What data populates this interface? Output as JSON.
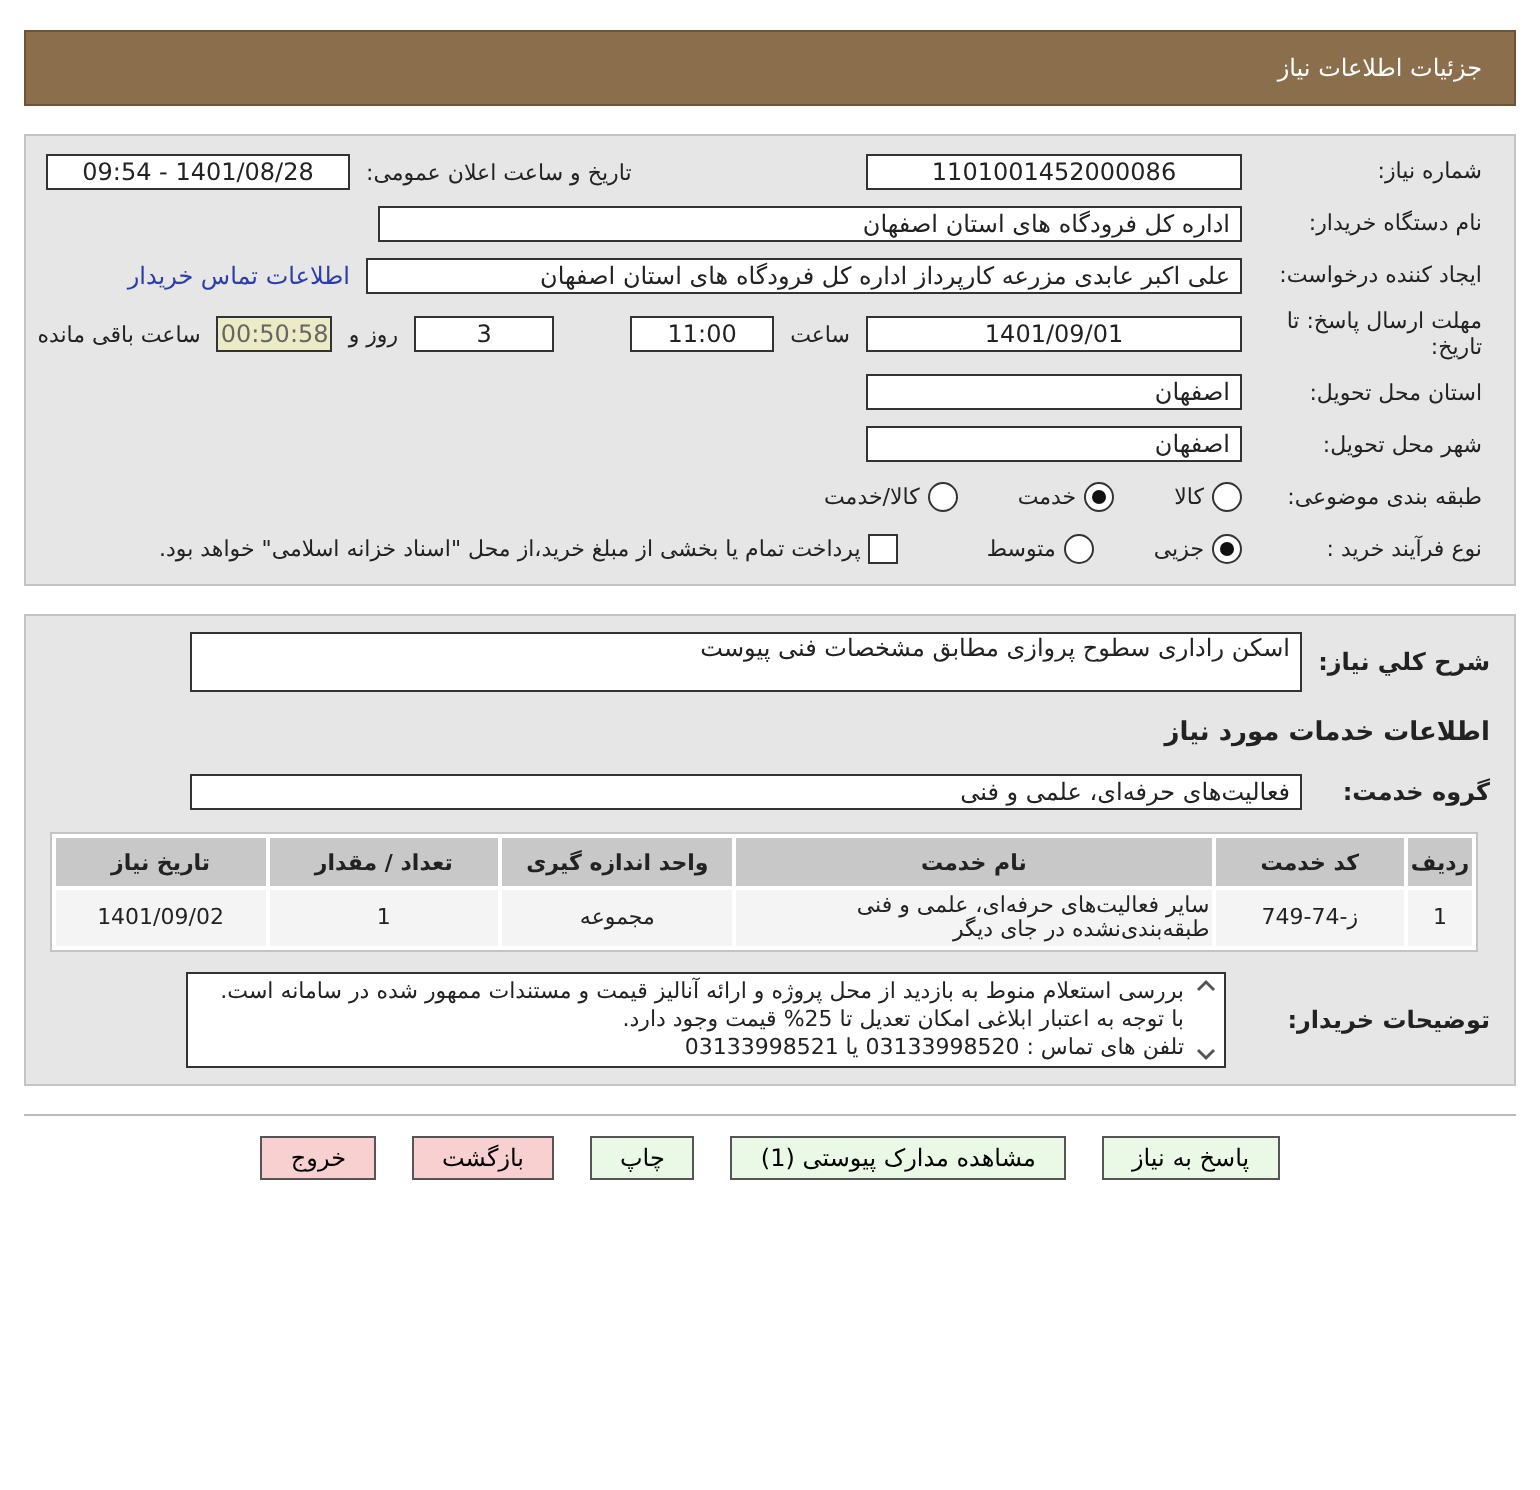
{
  "header": {
    "title": "جزئیات اطلاعات نیاز"
  },
  "need_number": {
    "label": "شماره نیاز:",
    "value": "1101001452000086"
  },
  "announce": {
    "label": "تاریخ و ساعت اعلان عمومی:",
    "value": "1401/08/28 - 09:54"
  },
  "buyer": {
    "label": "نام دستگاه خریدار:",
    "value": "اداره کل فرودگاه های استان اصفهان"
  },
  "creator": {
    "label": "ایجاد کننده درخواست:",
    "value": "علی اکبر عابدی مزرعه کارپرداز اداره کل فرودگاه های استان اصفهان",
    "link": "اطلاعات تماس خریدار"
  },
  "deadline": {
    "label": "مهلت ارسال پاسخ: تا تاریخ:",
    "date": "1401/09/01",
    "time_label": "ساعت",
    "time": "11:00",
    "days": "3",
    "days_label": "روز و",
    "remaining": "00:50:58",
    "remaining_label": "ساعت باقی مانده"
  },
  "province": {
    "label": "استان محل تحویل:",
    "value": "اصفهان"
  },
  "city": {
    "label": "شهر محل تحویل:",
    "value": "اصفهان"
  },
  "category": {
    "label": "طبقه بندی موضوعی:",
    "options": [
      {
        "label": "کالا",
        "selected": false
      },
      {
        "label": "خدمت",
        "selected": true
      },
      {
        "label": "کالا/خدمت",
        "selected": false
      }
    ]
  },
  "process": {
    "label": "نوع فرآیند خرید :",
    "options": [
      {
        "label": "جزیی",
        "selected": true
      },
      {
        "label": "متوسط",
        "selected": false
      }
    ],
    "payment": {
      "checked": false,
      "text": "پرداخت تمام یا بخشی از مبلغ خرید،از محل \"اسناد خزانه اسلامی\" خواهد بود."
    }
  },
  "summary": {
    "label": "شرح کلي نياز:",
    "value": "اسکن راداری سطوح پروازی مطابق مشخصات فنی پیوست"
  },
  "services_title": "اطلاعات خدمات مورد نیاز",
  "service_group": {
    "label": "گروه خدمت:",
    "value": "فعالیت‌های حرفه‌ای، علمی و فنی"
  },
  "table": {
    "columns": [
      "ردیف",
      "کد خدمت",
      "نام خدمت",
      "واحد اندازه گیری",
      "تعداد / مقدار",
      "تاریخ نیاز"
    ],
    "rows": [
      [
        "1",
        "ز-74-749",
        "سایر فعالیت‌های حرفه‌ای، علمی و فنی طبقه‌بندی‌نشده در جای دیگر",
        "مجموعه",
        "1",
        "1401/09/02"
      ]
    ]
  },
  "notes": {
    "label": "توضیحات خریدار:",
    "lines": [
      "بررسی استعلام منوط  به بازدید از محل پروژه و  ارائه آنالیز قیمت و مستندات ممهور شده در سامانه است.",
      "با توجه به اعتبار ابلاغی امکان تعدیل تا 25% قیمت وجود دارد.",
      "تلفن های تماس : 03133998520 یا 03133998521"
    ]
  },
  "buttons": [
    {
      "label": "پاسخ به نیاز",
      "kind": "normal"
    },
    {
      "label": "مشاهده مدارک پیوستی (1)",
      "kind": "normal"
    },
    {
      "label": "چاپ",
      "kind": "normal"
    },
    {
      "label": "بازگشت",
      "kind": "danger"
    },
    {
      "label": "خروج",
      "kind": "danger"
    }
  ]
}
